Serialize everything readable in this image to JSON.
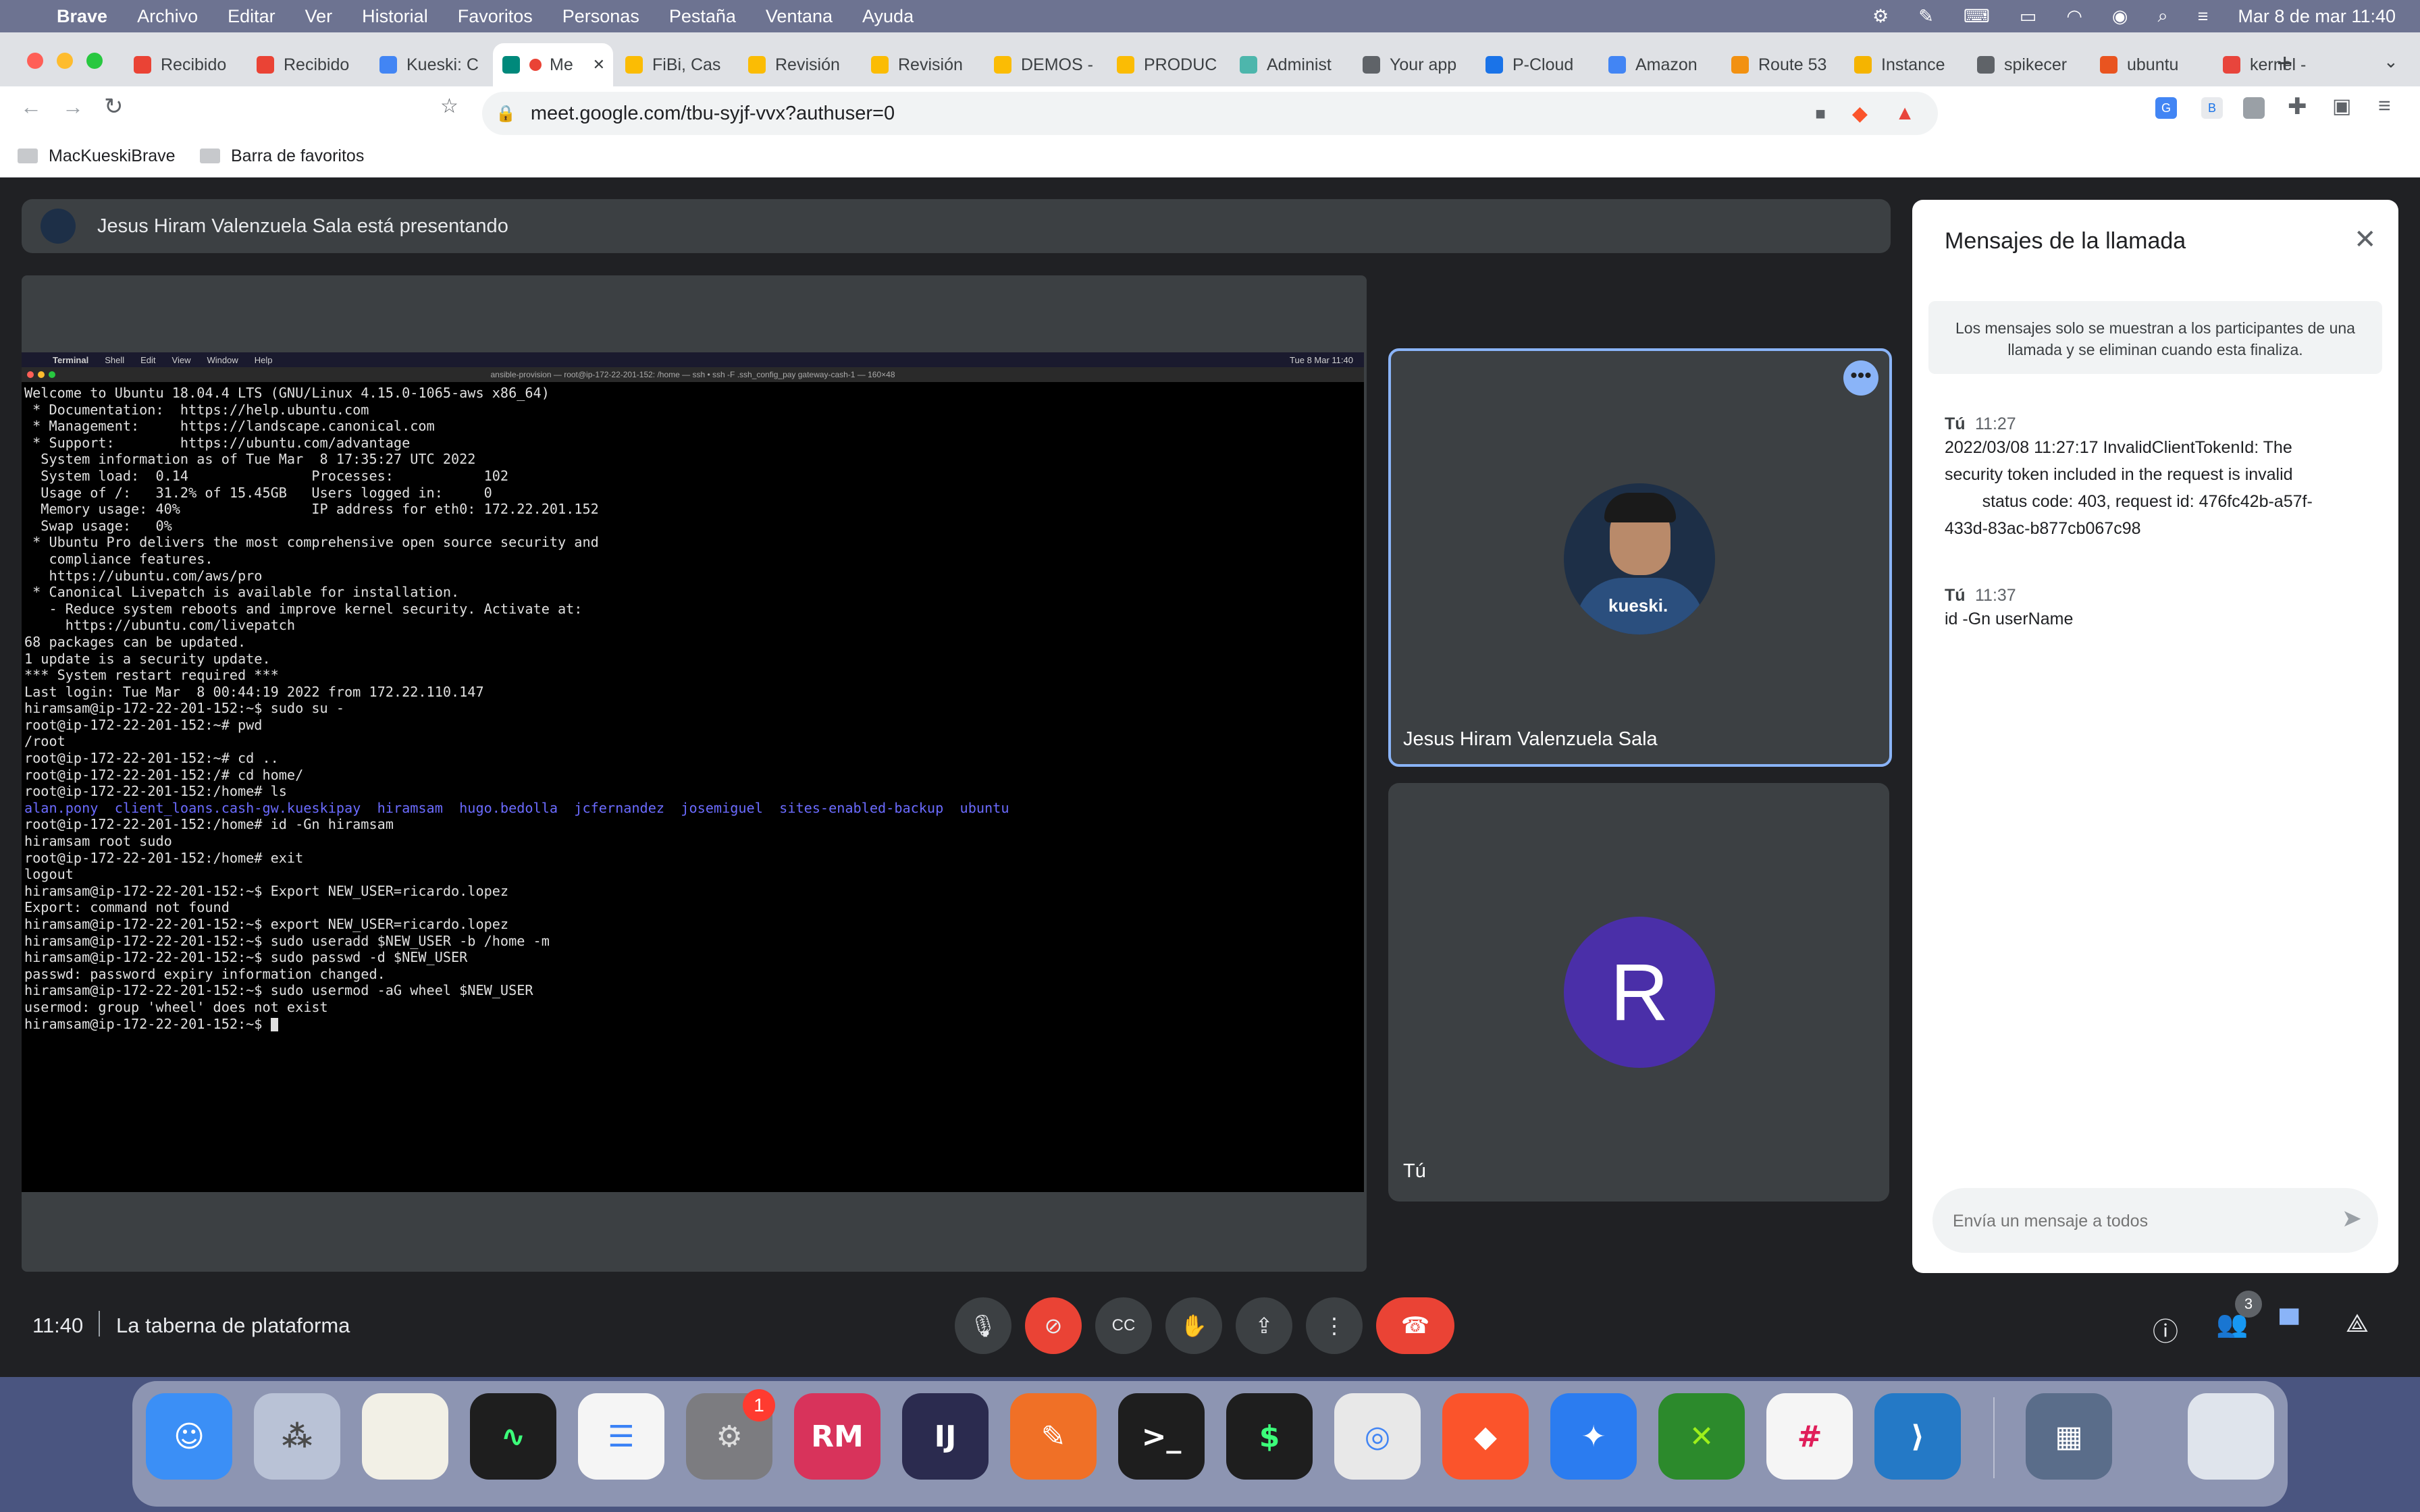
{
  "menubar": {
    "app": "Brave",
    "items": [
      "Archivo",
      "Editar",
      "Ver",
      "Historial",
      "Favoritos",
      "Personas",
      "Pestaña",
      "Ventana",
      "Ayuda"
    ],
    "datetime": "Mar 8 de mar  11:40"
  },
  "tabs": [
    {
      "label": "Recibido",
      "color": "#ea4335"
    },
    {
      "label": "Recibido",
      "color": "#ea4335"
    },
    {
      "label": "Kueski: C",
      "color": "#4285f4"
    },
    {
      "label": "Me",
      "color": "#00897b"
    },
    {
      "label": "FiBi, Cas",
      "color": "#fbbc04"
    },
    {
      "label": "Revisión",
      "color": "#fbbc04"
    },
    {
      "label": "Revisión",
      "color": "#fbbc04"
    },
    {
      "label": "DEMOS -",
      "color": "#fbbc04"
    },
    {
      "label": "PRODUC",
      "color": "#fbbc04"
    },
    {
      "label": "Administ",
      "color": "#4db6ac"
    },
    {
      "label": "Your app",
      "color": "#5f6368"
    },
    {
      "label": "P-Cloud",
      "color": "#1a73e8"
    },
    {
      "label": "Amazon",
      "color": "#4285f4"
    },
    {
      "label": "Route 53",
      "color": "#f29111"
    },
    {
      "label": "Instance",
      "color": "#f5b400"
    },
    {
      "label": "spikecer",
      "color": "#5f6368"
    },
    {
      "label": "ubuntu",
      "color": "#e95420"
    },
    {
      "label": "kernel -",
      "color": "#e8453c"
    }
  ],
  "address_bar": {
    "url": "meet.google.com/tbu-syjf-vvx?authuser=0"
  },
  "bookmarks": [
    {
      "label": "MacKueskiBrave"
    },
    {
      "label": "Barra de favoritos"
    }
  ],
  "presenting_banner": "Jesus Hiram Valenzuela Sala está presentando",
  "terminal": {
    "menubar_items": [
      "Terminal",
      "Shell",
      "Edit",
      "View",
      "Window",
      "Help"
    ],
    "clock": "Tue 8 Mar 11:40",
    "window_title": "ansible-provision — root@ip-172-22-201-152: /home — ssh • ssh -F .ssh_config_pay gateway-cash-1 — 160×48",
    "lines": [
      "Welcome to Ubuntu 18.04.4 LTS (GNU/Linux 4.15.0-1065-aws x86_64)",
      "",
      " * Documentation:  https://help.ubuntu.com",
      " * Management:     https://landscape.canonical.com",
      " * Support:        https://ubuntu.com/advantage",
      "",
      "  System information as of Tue Mar  8 17:35:27 UTC 2022",
      "",
      "  System load:  0.14               Processes:           102",
      "  Usage of /:   31.2% of 15.45GB   Users logged in:     0",
      "  Memory usage: 40%                IP address for eth0: 172.22.201.152",
      "  Swap usage:   0%",
      "",
      " * Ubuntu Pro delivers the most comprehensive open source security and",
      "   compliance features.",
      "",
      "   https://ubuntu.com/aws/pro",
      "",
      " * Canonical Livepatch is available for installation.",
      "   - Reduce system reboots and improve kernel security. Activate at:",
      "     https://ubuntu.com/livepatch",
      "",
      "68 packages can be updated.",
      "1 update is a security update.",
      "",
      "",
      "*** System restart required ***",
      "Last login: Tue Mar  8 00:44:19 2022 from 172.22.110.147",
      "hiramsam@ip-172-22-201-152:~$ sudo su -",
      "root@ip-172-22-201-152:~# pwd",
      "/root",
      "root@ip-172-22-201-152:~# cd ..",
      "root@ip-172-22-201-152:/# cd home/",
      "root@ip-172-22-201-152:/home# ls",
      "alan.pony  client_loans.cash-gw.kueskipay  hiramsam  hugo.bedolla  jcfernandez  josemiguel  sites-enabled-backup  ubuntu",
      "root@ip-172-22-201-152:/home# id -Gn hiramsam",
      "hiramsam root sudo",
      "root@ip-172-22-201-152:/home# exit",
      "logout",
      "hiramsam@ip-172-22-201-152:~$ Export NEW_USER=ricardo.lopez",
      "Export: command not found",
      "hiramsam@ip-172-22-201-152:~$ export NEW_USER=ricardo.lopez",
      "hiramsam@ip-172-22-201-152:~$ sudo useradd $NEW_USER -b /home -m",
      "hiramsam@ip-172-22-201-152:~$ sudo passwd -d $NEW_USER",
      "passwd: password expiry information changed.",
      "hiramsam@ip-172-22-201-152:~$ sudo usermod -aG wheel $NEW_USER",
      "usermod: group 'wheel' does not exist",
      "hiramsam@ip-172-22-201-152:~$ "
    ]
  },
  "participants": [
    {
      "name": "Jesus Hiram Valenzuela Sala",
      "shirt_text": "kueski."
    },
    {
      "name": "Tú",
      "initial": "R",
      "color": "#4a2fa8"
    }
  ],
  "chat": {
    "title": "Mensajes de la llamada",
    "notice": "Los mensajes solo se muestran a los participantes de una llamada y se eliminan cuando esta finaliza.",
    "messages": [
      {
        "sender": "Tú",
        "time": "11:27",
        "lines": [
          "2022/03/08 11:27:17 InvalidClientTokenId: The",
          "security token included in the request is invalid",
          "        status code: 403, request id: 476fc42b-a57f-",
          "433d-83ac-b877cb067c98"
        ]
      },
      {
        "sender": "Tú",
        "time": "11:37",
        "lines": [
          "id -Gn userName"
        ]
      }
    ],
    "input_placeholder": "Envía un mensaje a todos"
  },
  "bottombar": {
    "time": "11:40",
    "meeting_name": "La taberna de plataforma",
    "people_count": "3"
  },
  "dock": {
    "badge_system_prefs": "1",
    "apps": [
      "Finder",
      "Launchpad",
      "Notes",
      "Activity Monitor",
      "Reminders",
      "System Preferences",
      "RubyMine",
      "IntelliJ IDEA",
      "Postman",
      "Terminal",
      "Terminal",
      "Chrome",
      "Brave",
      "Safari",
      "XMind",
      "Slack",
      "VS Code",
      "VirtualBox",
      "Trash"
    ]
  }
}
